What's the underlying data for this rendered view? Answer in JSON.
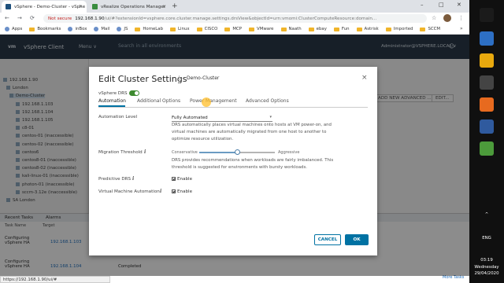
{
  "browser": {
    "tabs": [
      {
        "title": "vSphere - Demo-Cluster - vSphe",
        "close": "×",
        "active": true
      },
      {
        "title": "vRealize Operations Manager",
        "close": "×",
        "active": false
      }
    ],
    "new_tab": "+",
    "window_controls": {
      "minimize": "–",
      "maximize": "□",
      "close": "✕"
    },
    "nav": {
      "back": "←",
      "forward": "→",
      "reload": "⟳"
    },
    "address": {
      "warning": "Not secure",
      "host": "192.168.1.90",
      "path": "/ui/#?extensionId=vsphere.core.cluster.manage.settings.drsView&objectId=urn:vmomi:ClusterComputeResource:domain..."
    },
    "star": "☆",
    "menu_dots": "⋮",
    "bookmarks": [
      {
        "label": "Apps",
        "kind": "grid"
      },
      {
        "label": "Bookmarks",
        "kind": "folder"
      },
      {
        "label": "inBox",
        "kind": "site"
      },
      {
        "label": "Mail",
        "kind": "site"
      },
      {
        "label": "JS",
        "kind": "site"
      },
      {
        "label": "HomeLab",
        "kind": "folder"
      },
      {
        "label": "Linux",
        "kind": "folder"
      },
      {
        "label": "CISCO",
        "kind": "folder"
      },
      {
        "label": "MCP",
        "kind": "folder"
      },
      {
        "label": "VMware",
        "kind": "folder"
      },
      {
        "label": "Naath",
        "kind": "folder"
      },
      {
        "label": "ebay",
        "kind": "folder"
      },
      {
        "label": "Fun",
        "kind": "folder"
      },
      {
        "label": "Astrisk",
        "kind": "folder"
      },
      {
        "label": "Imported",
        "kind": "folder"
      },
      {
        "label": "SCCM",
        "kind": "folder"
      }
    ],
    "bookmarks_more": "»",
    "status_url": "https://192.168.1.90/ui/#"
  },
  "app": {
    "logo": "vm",
    "title": "vSphere Client",
    "menu": "Menu ∨",
    "search": "Search in all environments",
    "user": "Administrator@VSPHERE.LOCAL ∨",
    "help_icon": "?",
    "smile_icon": "☺"
  },
  "tree": [
    {
      "label": "192.168.1.90",
      "selected": false
    },
    {
      "label": "London",
      "selected": false
    },
    {
      "label": "Demo-Cluster",
      "selected": true
    },
    {
      "label": "192.168.1.103",
      "selected": false
    },
    {
      "label": "192.168.1.104",
      "selected": false
    },
    {
      "label": "192.168.1.105",
      "selected": false
    },
    {
      "label": "c8-01",
      "selected": false
    },
    {
      "label": "centos-01 (inaccessible)",
      "selected": false
    },
    {
      "label": "centos-02 (inaccessible)",
      "selected": false
    },
    {
      "label": "centos6",
      "selected": false
    },
    {
      "label": "centos8-01 (inaccessible)",
      "selected": false
    },
    {
      "label": "centos8-02 (inaccessible)",
      "selected": false
    },
    {
      "label": "kali-linux-01 (inaccessible)",
      "selected": false
    },
    {
      "label": "photon-01 (inaccessible)",
      "selected": false
    },
    {
      "label": "sccm-3.12e (inaccessible)",
      "selected": false
    },
    {
      "label": "SA London",
      "selected": false
    }
  ],
  "right_panel": {
    "filter_btn": "ADD NEW ADVANCED ...",
    "edit_btn": "EDIT..."
  },
  "tasks": {
    "tabs": [
      "Recent Tasks",
      "Alarms"
    ],
    "headers": [
      "Task Name",
      "Target"
    ],
    "rows": [
      {
        "name": "Configuring vSphere HA",
        "target": "192.168.1.103",
        "status": ""
      },
      {
        "name": "Configuring vSphere HA",
        "target": "192.168.1.104",
        "status": "Completed"
      }
    ],
    "more_tasks": "More Tasks"
  },
  "modal": {
    "title": "Edit Cluster Settings",
    "subtitle": "Demo-Cluster",
    "close": "×",
    "drs_label": "vSphere DRS",
    "drs_enabled": true,
    "tabs": [
      "Automation",
      "Additional Options",
      "Power Management",
      "Advanced Options"
    ],
    "active_tab": "Automation",
    "automation_level": {
      "label": "Automation Level",
      "value": "Fully Automated",
      "description": "DRS automatically places virtual machines onto hosts at VM power-on, and virtual machines are automatically migrated from one host to another to optimize resource utilization."
    },
    "migration_threshold": {
      "label": "Migration Threshold",
      "info": "i",
      "min_label": "Conservative",
      "max_label": "Aggressive",
      "level": 3,
      "max_level": 5,
      "description": "DRS provides recommendations when workloads are fairly imbalanced. This threshold is suggested for environments with bursty workloads."
    },
    "predictive_drs": {
      "label": "Predictive DRS",
      "info": "i",
      "checkbox": "Enable",
      "checked": true
    },
    "vm_automation": {
      "label": "Virtual Machine Automation",
      "info": "i",
      "checkbox": "Enable",
      "checked": true
    },
    "cancel": "CANCEL",
    "ok": "OK"
  },
  "taskbar": {
    "lang": "ENG",
    "time": "03:19",
    "day": "Wednesday",
    "date": "29/04/2020",
    "chevron": "^"
  },
  "colors": {
    "accent": "#0072a3",
    "header": "#2b3a4a",
    "toggle": "#3c8a2e",
    "taskbar": "#101010"
  }
}
